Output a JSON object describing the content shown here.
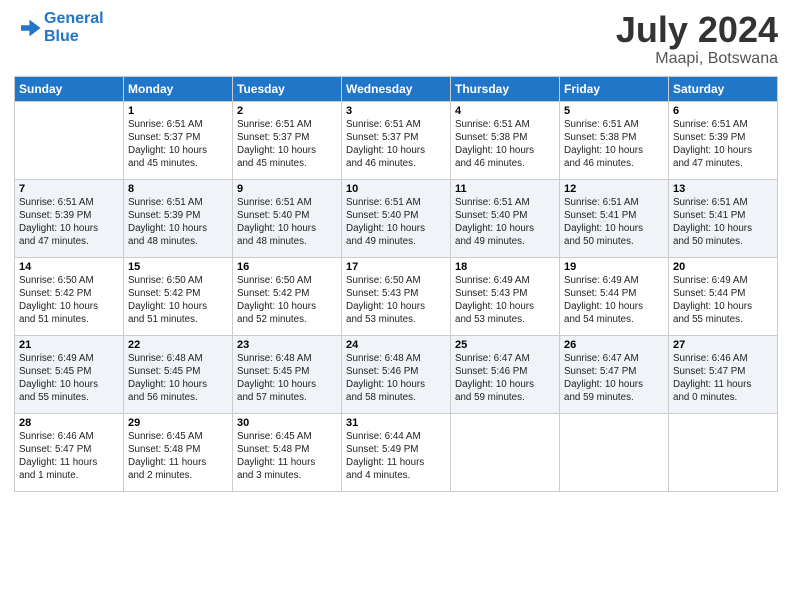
{
  "header": {
    "logo_line1": "General",
    "logo_line2": "Blue",
    "title": "July 2024",
    "subtitle": "Maapi, Botswana"
  },
  "days_of_week": [
    "Sunday",
    "Monday",
    "Tuesday",
    "Wednesday",
    "Thursday",
    "Friday",
    "Saturday"
  ],
  "weeks": [
    [
      {
        "day": "",
        "info": ""
      },
      {
        "day": "1",
        "info": "Sunrise: 6:51 AM\nSunset: 5:37 PM\nDaylight: 10 hours\nand 45 minutes."
      },
      {
        "day": "2",
        "info": "Sunrise: 6:51 AM\nSunset: 5:37 PM\nDaylight: 10 hours\nand 45 minutes."
      },
      {
        "day": "3",
        "info": "Sunrise: 6:51 AM\nSunset: 5:37 PM\nDaylight: 10 hours\nand 46 minutes."
      },
      {
        "day": "4",
        "info": "Sunrise: 6:51 AM\nSunset: 5:38 PM\nDaylight: 10 hours\nand 46 minutes."
      },
      {
        "day": "5",
        "info": "Sunrise: 6:51 AM\nSunset: 5:38 PM\nDaylight: 10 hours\nand 46 minutes."
      },
      {
        "day": "6",
        "info": "Sunrise: 6:51 AM\nSunset: 5:39 PM\nDaylight: 10 hours\nand 47 minutes."
      }
    ],
    [
      {
        "day": "7",
        "info": "Sunrise: 6:51 AM\nSunset: 5:39 PM\nDaylight: 10 hours\nand 47 minutes."
      },
      {
        "day": "8",
        "info": "Sunrise: 6:51 AM\nSunset: 5:39 PM\nDaylight: 10 hours\nand 48 minutes."
      },
      {
        "day": "9",
        "info": "Sunrise: 6:51 AM\nSunset: 5:40 PM\nDaylight: 10 hours\nand 48 minutes."
      },
      {
        "day": "10",
        "info": "Sunrise: 6:51 AM\nSunset: 5:40 PM\nDaylight: 10 hours\nand 49 minutes."
      },
      {
        "day": "11",
        "info": "Sunrise: 6:51 AM\nSunset: 5:40 PM\nDaylight: 10 hours\nand 49 minutes."
      },
      {
        "day": "12",
        "info": "Sunrise: 6:51 AM\nSunset: 5:41 PM\nDaylight: 10 hours\nand 50 minutes."
      },
      {
        "day": "13",
        "info": "Sunrise: 6:51 AM\nSunset: 5:41 PM\nDaylight: 10 hours\nand 50 minutes."
      }
    ],
    [
      {
        "day": "14",
        "info": "Sunrise: 6:50 AM\nSunset: 5:42 PM\nDaylight: 10 hours\nand 51 minutes."
      },
      {
        "day": "15",
        "info": "Sunrise: 6:50 AM\nSunset: 5:42 PM\nDaylight: 10 hours\nand 51 minutes."
      },
      {
        "day": "16",
        "info": "Sunrise: 6:50 AM\nSunset: 5:42 PM\nDaylight: 10 hours\nand 52 minutes."
      },
      {
        "day": "17",
        "info": "Sunrise: 6:50 AM\nSunset: 5:43 PM\nDaylight: 10 hours\nand 53 minutes."
      },
      {
        "day": "18",
        "info": "Sunrise: 6:49 AM\nSunset: 5:43 PM\nDaylight: 10 hours\nand 53 minutes."
      },
      {
        "day": "19",
        "info": "Sunrise: 6:49 AM\nSunset: 5:44 PM\nDaylight: 10 hours\nand 54 minutes."
      },
      {
        "day": "20",
        "info": "Sunrise: 6:49 AM\nSunset: 5:44 PM\nDaylight: 10 hours\nand 55 minutes."
      }
    ],
    [
      {
        "day": "21",
        "info": "Sunrise: 6:49 AM\nSunset: 5:45 PM\nDaylight: 10 hours\nand 55 minutes."
      },
      {
        "day": "22",
        "info": "Sunrise: 6:48 AM\nSunset: 5:45 PM\nDaylight: 10 hours\nand 56 minutes."
      },
      {
        "day": "23",
        "info": "Sunrise: 6:48 AM\nSunset: 5:45 PM\nDaylight: 10 hours\nand 57 minutes."
      },
      {
        "day": "24",
        "info": "Sunrise: 6:48 AM\nSunset: 5:46 PM\nDaylight: 10 hours\nand 58 minutes."
      },
      {
        "day": "25",
        "info": "Sunrise: 6:47 AM\nSunset: 5:46 PM\nDaylight: 10 hours\nand 59 minutes."
      },
      {
        "day": "26",
        "info": "Sunrise: 6:47 AM\nSunset: 5:47 PM\nDaylight: 10 hours\nand 59 minutes."
      },
      {
        "day": "27",
        "info": "Sunrise: 6:46 AM\nSunset: 5:47 PM\nDaylight: 11 hours\nand 0 minutes."
      }
    ],
    [
      {
        "day": "28",
        "info": "Sunrise: 6:46 AM\nSunset: 5:47 PM\nDaylight: 11 hours\nand 1 minute."
      },
      {
        "day": "29",
        "info": "Sunrise: 6:45 AM\nSunset: 5:48 PM\nDaylight: 11 hours\nand 2 minutes."
      },
      {
        "day": "30",
        "info": "Sunrise: 6:45 AM\nSunset: 5:48 PM\nDaylight: 11 hours\nand 3 minutes."
      },
      {
        "day": "31",
        "info": "Sunrise: 6:44 AM\nSunset: 5:49 PM\nDaylight: 11 hours\nand 4 minutes."
      },
      {
        "day": "",
        "info": ""
      },
      {
        "day": "",
        "info": ""
      },
      {
        "day": "",
        "info": ""
      }
    ]
  ]
}
